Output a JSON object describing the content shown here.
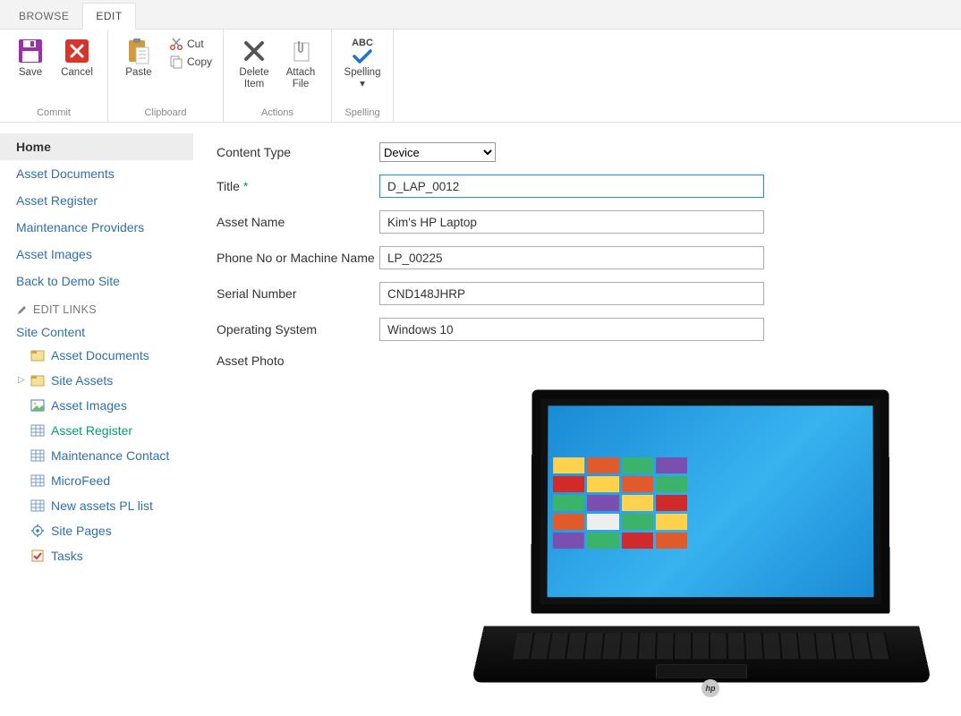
{
  "tabs": {
    "browse": "BROWSE",
    "edit": "EDIT",
    "active": "edit"
  },
  "ribbon": {
    "commit": {
      "label": "Commit",
      "save": "Save",
      "cancel": "Cancel"
    },
    "clipboard": {
      "label": "Clipboard",
      "paste": "Paste",
      "cut": "Cut",
      "copy": "Copy"
    },
    "actions": {
      "label": "Actions",
      "delete": "Delete Item",
      "attach": "Attach File"
    },
    "spelling": {
      "label": "Spelling",
      "spelling": "Spelling",
      "abc": "ABC"
    }
  },
  "nav": {
    "items": [
      {
        "label": "Home",
        "selected": true
      },
      {
        "label": "Asset Documents"
      },
      {
        "label": "Asset Register"
      },
      {
        "label": "Maintenance Providers"
      },
      {
        "label": "Asset Images"
      },
      {
        "label": "Back to Demo Site"
      }
    ],
    "edit_links": "EDIT LINKS",
    "site_content": "Site Content",
    "tree": [
      {
        "label": "Asset Documents",
        "icon": "doc"
      },
      {
        "label": "Site Assets",
        "icon": "doc",
        "expandable": true
      },
      {
        "label": "Asset Images",
        "icon": "img"
      },
      {
        "label": "Asset Register",
        "icon": "grid",
        "active": true
      },
      {
        "label": "Maintenance Contact",
        "icon": "grid"
      },
      {
        "label": "MicroFeed",
        "icon": "grid"
      },
      {
        "label": "New assets PL list",
        "icon": "grid"
      },
      {
        "label": "Site Pages",
        "icon": "gear"
      },
      {
        "label": "Tasks",
        "icon": "check"
      }
    ]
  },
  "form": {
    "content_type": {
      "label": "Content Type",
      "value": "Device"
    },
    "title": {
      "label": "Title",
      "required": "*",
      "value": "D_LAP_0012"
    },
    "asset_name": {
      "label": "Asset Name",
      "value": "Kim's HP Laptop"
    },
    "phone_machine": {
      "label": "Phone No or Machine Name",
      "value": "LP_00225"
    },
    "serial": {
      "label": "Serial Number",
      "value": "CND148JHRP"
    },
    "os": {
      "label": "Operating System",
      "value": "Windows 10"
    },
    "photo": {
      "label": "Asset Photo"
    }
  }
}
